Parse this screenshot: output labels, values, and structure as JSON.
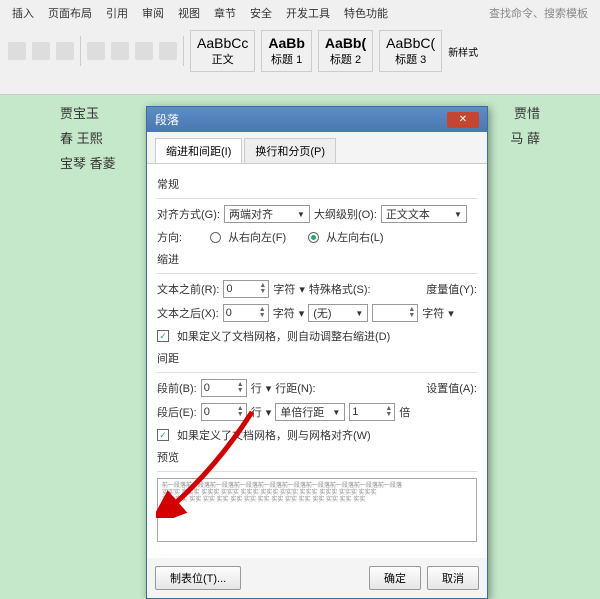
{
  "ribbon": {
    "tabs": [
      "插入",
      "页面布局",
      "引用",
      "审阅",
      "视图",
      "章节",
      "安全",
      "开发工具",
      "特色功能"
    ],
    "search_placeholder": "查找命令、搜索模板",
    "styles": [
      {
        "sample": "AaBbCc",
        "name": "正文"
      },
      {
        "sample": "AaBb",
        "name": "标题 1"
      },
      {
        "sample": "AaBb(",
        "name": "标题 2"
      },
      {
        "sample": "AaBbC(",
        "name": "标题 3"
      }
    ],
    "new_style": "新样式"
  },
  "doc": {
    "line1": "贾宝玉",
    "line1b": "贾惜",
    "line2": "春 王熙",
    "line2b": "马  薛",
    "line3": "宝琴 香菱"
  },
  "dialog": {
    "title": "段落",
    "tabs": {
      "a": "缩进和间距(I)",
      "b": "换行和分页(P)"
    },
    "group_general": "常规",
    "align_label": "对齐方式(G):",
    "align_value": "两端对齐",
    "outline_label": "大纲级别(O):",
    "outline_value": "正文文本",
    "direction_label": "方向:",
    "dir_rtl": "从右向左(F)",
    "dir_ltr": "从左向右(L)",
    "group_indent": "缩进",
    "before_label": "文本之前(R):",
    "before_val": "0",
    "unit_char": "字符",
    "after_label": "文本之后(X):",
    "after_val": "0",
    "special_label": "特殊格式(S):",
    "special_val": "(无)",
    "measure_label": "度量值(Y):",
    "auto_adjust": "如果定义了文档网格，则自动调整右缩进(D)",
    "group_spacing": "间距",
    "space_before_label": "段前(B):",
    "space_before_val": "0",
    "unit_line": "行",
    "space_after_label": "段后(E):",
    "space_after_val": "0",
    "line_spacing_label": "行距(N):",
    "line_spacing_val": "单倍行距",
    "set_value_label": "设置值(A):",
    "set_value_val": "1",
    "unit_bei": "倍",
    "snap_grid": "如果定义了文档网格，则与网格对齐(W)",
    "group_preview": "预览",
    "btn_tabstops": "制表位(T)...",
    "btn_ok": "确定",
    "btn_cancel": "取消"
  }
}
